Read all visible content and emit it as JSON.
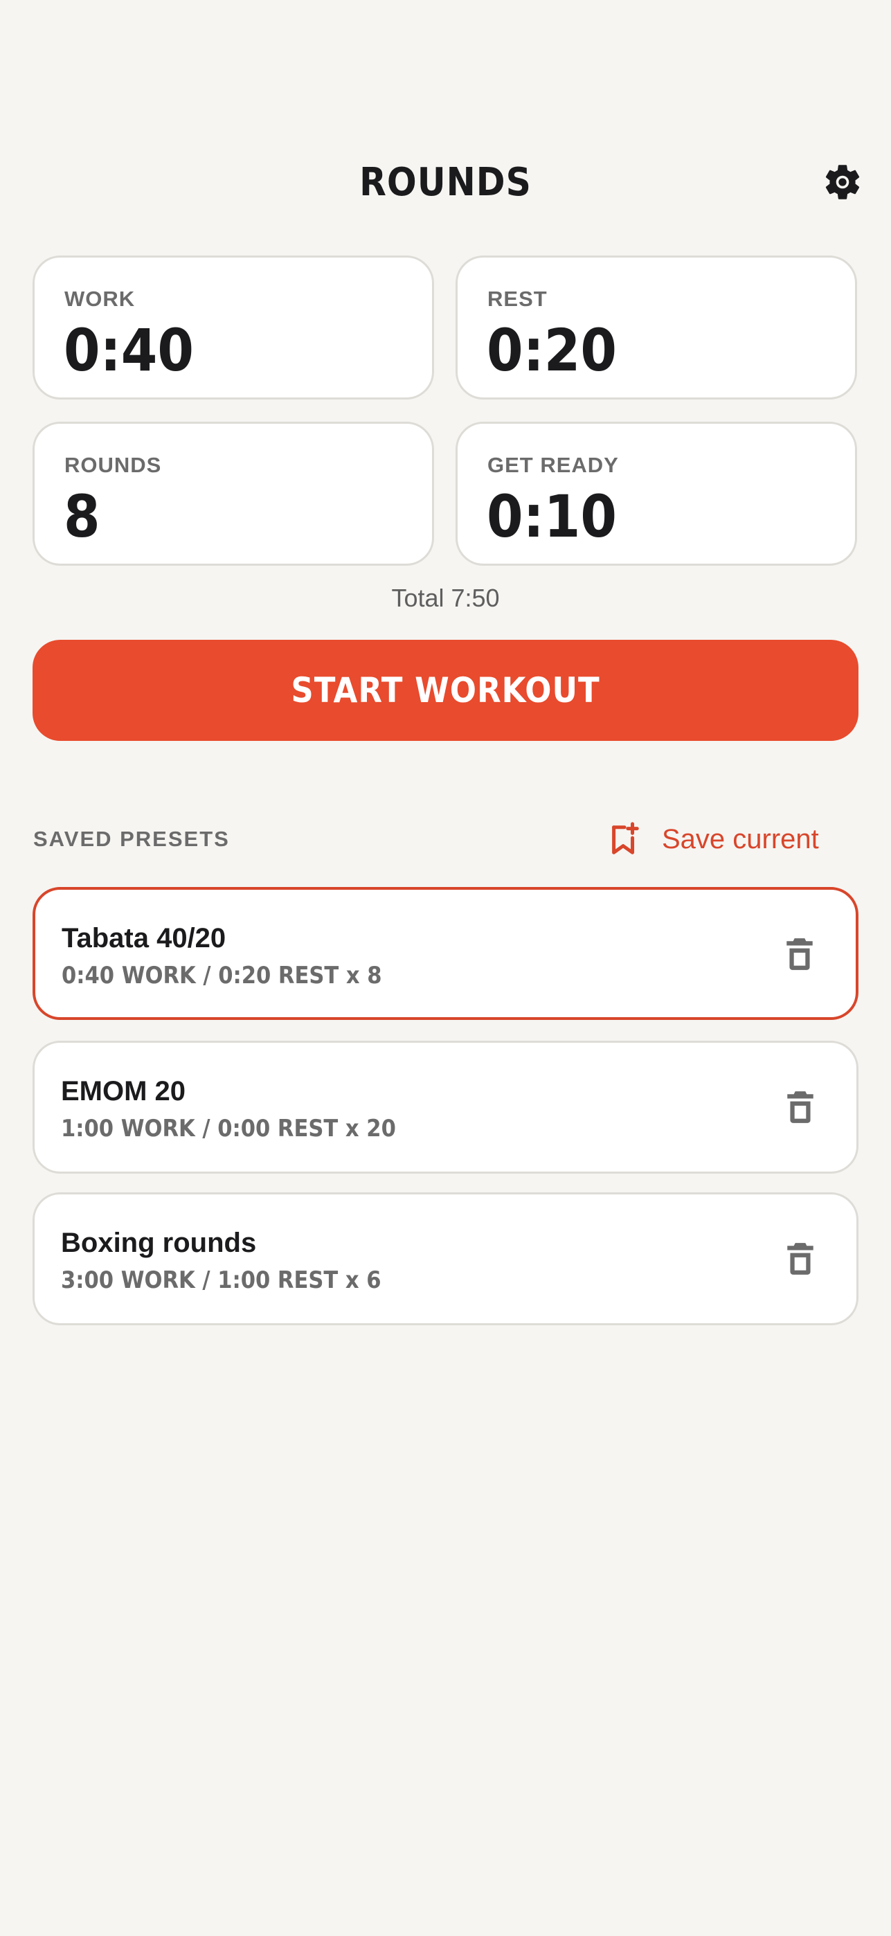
{
  "header": {
    "title": "ROUNDS",
    "settings_icon": "gear-icon"
  },
  "stats": {
    "work": {
      "label": "WORK",
      "value": "0:40"
    },
    "rest": {
      "label": "REST",
      "value": "0:20"
    },
    "rounds": {
      "label": "ROUNDS",
      "value": "8"
    },
    "get_ready": {
      "label": "GET READY",
      "value": "0:10"
    }
  },
  "total": "Total 7:50",
  "start_button": "START WORKOUT",
  "presets_section": {
    "label": "SAVED PRESETS",
    "save_current_label": "Save current",
    "save_icon": "bookmark-plus-icon"
  },
  "presets": [
    {
      "name": "Tabata 40/20",
      "meta": "0:40 WORK / 0:20 REST x 8",
      "selected": true
    },
    {
      "name": "EMOM 20",
      "meta": "1:00 WORK / 0:00 REST x 20",
      "selected": false
    },
    {
      "name": "Boxing rounds",
      "meta": "3:00 WORK / 1:00 REST x 6",
      "selected": false
    }
  ],
  "colors": {
    "background": "#f6f5f2",
    "accent": "#e84b2d",
    "text": "#1b1b1d",
    "muted": "#6b6b6b",
    "card_border": "#dedcd6"
  }
}
